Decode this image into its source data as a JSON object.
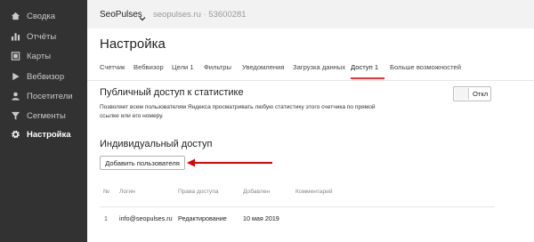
{
  "sidebar": {
    "items": [
      {
        "label": "Сводка",
        "icon": "home-icon"
      },
      {
        "label": "Отчёты",
        "icon": "bar-chart-icon"
      },
      {
        "label": "Карты",
        "icon": "map-icon"
      },
      {
        "label": "Вебвизор",
        "icon": "play-icon"
      },
      {
        "label": "Посетители",
        "icon": "user-icon"
      },
      {
        "label": "Сегменты",
        "icon": "filter-icon"
      },
      {
        "label": "Настройка",
        "icon": "gear-icon",
        "active": true
      }
    ]
  },
  "header": {
    "counter_name": "SeoPulses",
    "counter_site": "seopulses.ru · 53600281"
  },
  "page": {
    "title": "Настройка",
    "tabs": [
      {
        "label": "Счетчик"
      },
      {
        "label": "Вебвизор"
      },
      {
        "label": "Цели 1"
      },
      {
        "label": "Фильтры"
      },
      {
        "label": "Уведомления"
      },
      {
        "label": "Загрузка данных"
      },
      {
        "label": "Доступ 1",
        "active": true
      },
      {
        "label": "Больше возможностей"
      }
    ]
  },
  "public_access": {
    "title": "Публичный доступ к статистике",
    "description": "Позволяет всем пользователям Яндекса просматривать любую статистику этого счетчика по прямой ссылке или его номеру.",
    "toggle_label": "Откл",
    "toggle_on": false
  },
  "individual_access": {
    "title": "Индивидуальный доступ",
    "add_button_label": "Добавить пользователя",
    "columns": [
      "№",
      "Логин",
      "Права доступа",
      "Добавлен",
      "Комментарий"
    ],
    "rows": [
      {
        "num": "1",
        "login": "info@seopulses.ru",
        "rights": "Редактирование",
        "added": "10 мая 2019",
        "comment": ""
      }
    ]
  },
  "colors": {
    "sidebar_bg": "#323232",
    "accent_red": "#ff2d2d",
    "arrow_red": "#e00000"
  }
}
